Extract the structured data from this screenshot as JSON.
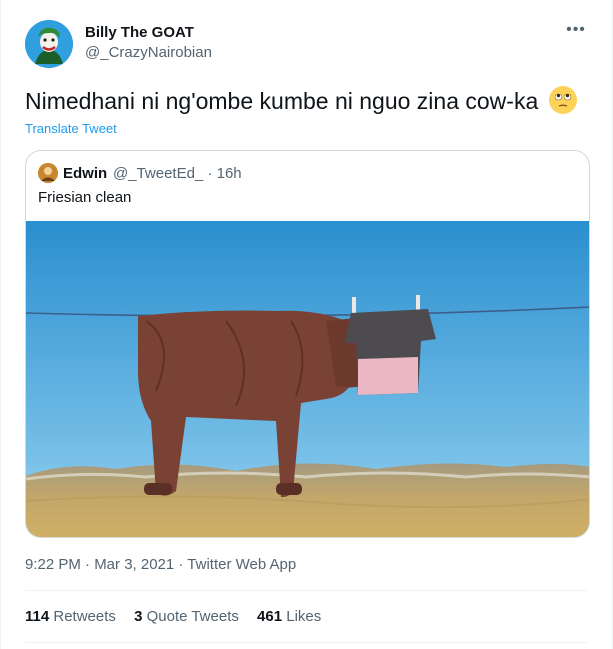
{
  "author": {
    "display_name": "Billy The GOAT",
    "handle": "@_CrazyNairobian"
  },
  "tweet": {
    "text": "Nimedhani ni ng'ombe kumbe ni nguo zina cow-ka",
    "emoji": "face-with-rolling-eyes-emoji",
    "translate_label": "Translate Tweet"
  },
  "quoted_tweet": {
    "display_name": "Edwin",
    "handle": "@_TweetEd_",
    "separator": "·",
    "time": "16h",
    "text": "Friesian clean",
    "image": "clothes-on-line-shaped-like-cow-photo"
  },
  "meta": {
    "timestamp": "9:22 PM · Mar 3, 2021 · Twitter Web App"
  },
  "stats": {
    "retweets_count": "114",
    "retweets_label": "Retweets",
    "quotes_count": "3",
    "quotes_label": "Quote Tweets",
    "likes_count": "461",
    "likes_label": "Likes"
  },
  "colors": {
    "accent": "#1d9bf0",
    "secondary_text": "#536471",
    "border": "#cfd9de"
  },
  "icons": {
    "more": "more-options-icon"
  }
}
